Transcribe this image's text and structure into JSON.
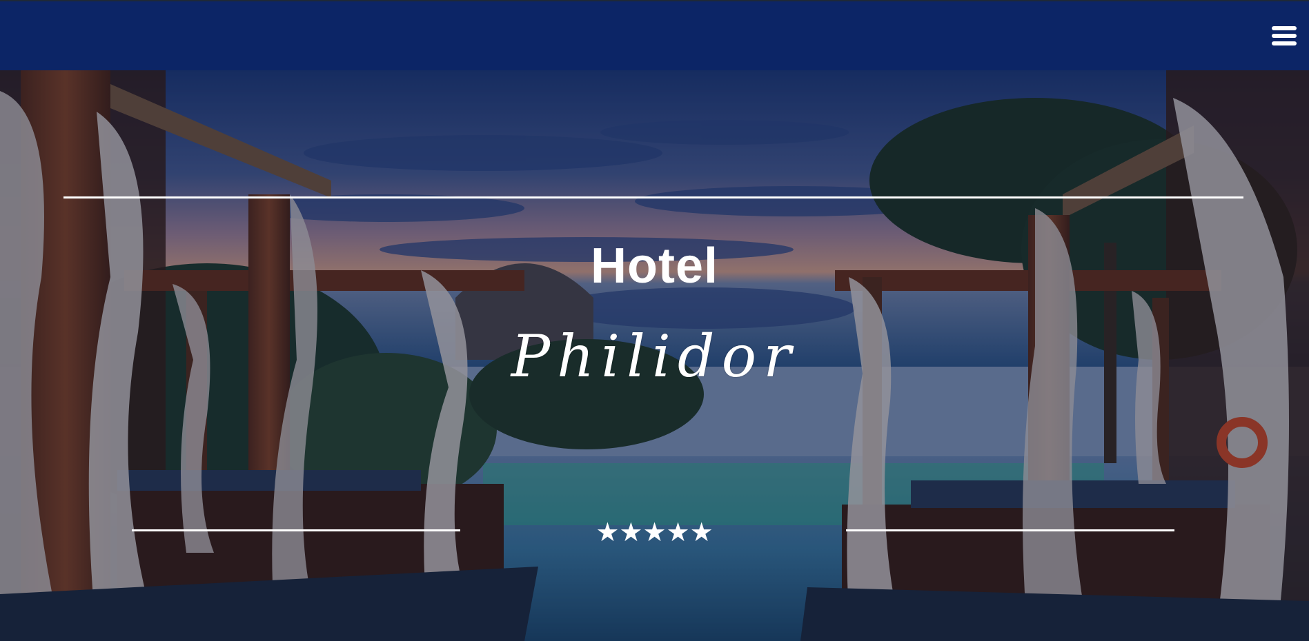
{
  "nav": {
    "menu_icon": "hamburger-menu-icon"
  },
  "hero": {
    "title": "Hotel",
    "name": "Philidor",
    "rating": {
      "stars": 5,
      "max": 5,
      "glyphs": "★★★★★"
    }
  },
  "colors": {
    "topbar": "#0c2566",
    "text": "#ffffff"
  }
}
